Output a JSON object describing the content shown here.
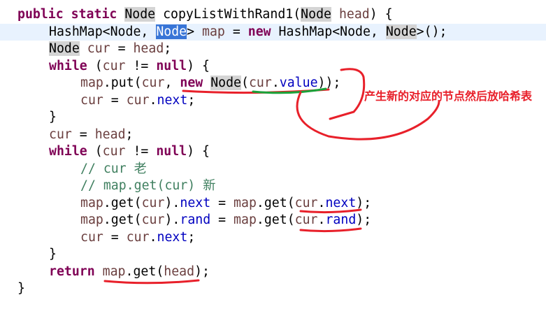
{
  "code": {
    "lines": [
      {
        "indent": 0,
        "segments": [
          {
            "t": "public",
            "c": "kw"
          },
          {
            "t": " "
          },
          {
            "t": "static",
            "c": "kw"
          },
          {
            "t": " "
          },
          {
            "t": "Node",
            "c": "hl"
          },
          {
            "t": " copyListWithRand1("
          },
          {
            "t": "Node",
            "c": "hl"
          },
          {
            "t": " "
          },
          {
            "t": "head",
            "c": "var"
          },
          {
            "t": ") {"
          }
        ]
      },
      {
        "indent": 1,
        "current": true,
        "segments": [
          {
            "t": "HashMap<Node, "
          },
          {
            "t": "Node",
            "c": "sel"
          },
          {
            "t": "> "
          },
          {
            "t": "map",
            "c": "var"
          },
          {
            "t": " = "
          },
          {
            "t": "new",
            "c": "kw"
          },
          {
            "t": " HashMap<Node, "
          },
          {
            "t": "Node",
            "c": "hl"
          },
          {
            "t": ">();"
          }
        ]
      },
      {
        "indent": 1,
        "segments": [
          {
            "t": "Node",
            "c": "hl"
          },
          {
            "t": " "
          },
          {
            "t": "cur",
            "c": "var"
          },
          {
            "t": " = "
          },
          {
            "t": "head",
            "c": "var"
          },
          {
            "t": ";"
          }
        ]
      },
      {
        "indent": 1,
        "segments": [
          {
            "t": "while",
            "c": "kw"
          },
          {
            "t": " ("
          },
          {
            "t": "cur",
            "c": "var"
          },
          {
            "t": " != "
          },
          {
            "t": "null",
            "c": "kw"
          },
          {
            "t": ") {"
          }
        ]
      },
      {
        "indent": 2,
        "segments": [
          {
            "t": "map",
            "c": "var"
          },
          {
            "t": ".put("
          },
          {
            "t": "cur",
            "c": "var"
          },
          {
            "t": ", "
          },
          {
            "t": "new",
            "c": "kw"
          },
          {
            "t": " "
          },
          {
            "t": "Node",
            "c": "hl"
          },
          {
            "t": "("
          },
          {
            "t": "cur",
            "c": "var"
          },
          {
            "t": "."
          },
          {
            "t": "value",
            "c": "fld"
          },
          {
            "t": "));"
          }
        ]
      },
      {
        "indent": 2,
        "segments": [
          {
            "t": "cur",
            "c": "var"
          },
          {
            "t": " = "
          },
          {
            "t": "cur",
            "c": "var"
          },
          {
            "t": "."
          },
          {
            "t": "next",
            "c": "fld"
          },
          {
            "t": ";"
          }
        ]
      },
      {
        "indent": 1,
        "segments": [
          {
            "t": "}"
          }
        ]
      },
      {
        "indent": 1,
        "segments": [
          {
            "t": "cur",
            "c": "var"
          },
          {
            "t": " = "
          },
          {
            "t": "head",
            "c": "var"
          },
          {
            "t": ";"
          }
        ]
      },
      {
        "indent": 1,
        "segments": [
          {
            "t": "while",
            "c": "kw"
          },
          {
            "t": " ("
          },
          {
            "t": "cur",
            "c": "var"
          },
          {
            "t": " != "
          },
          {
            "t": "null",
            "c": "kw"
          },
          {
            "t": ") {"
          }
        ]
      },
      {
        "indent": 2,
        "segments": [
          {
            "t": "// cur 老",
            "c": "cmt"
          }
        ]
      },
      {
        "indent": 2,
        "segments": [
          {
            "t": "// map.get(cur) 新",
            "c": "cmt"
          }
        ]
      },
      {
        "indent": 2,
        "segments": [
          {
            "t": "map",
            "c": "var"
          },
          {
            "t": ".get("
          },
          {
            "t": "cur",
            "c": "var"
          },
          {
            "t": ")."
          },
          {
            "t": "next",
            "c": "fld"
          },
          {
            "t": " = "
          },
          {
            "t": "map",
            "c": "var"
          },
          {
            "t": ".get("
          },
          {
            "t": "cur",
            "c": "var"
          },
          {
            "t": "."
          },
          {
            "t": "next",
            "c": "fld"
          },
          {
            "t": ");"
          }
        ]
      },
      {
        "indent": 2,
        "segments": [
          {
            "t": "map",
            "c": "var"
          },
          {
            "t": ".get("
          },
          {
            "t": "cur",
            "c": "var"
          },
          {
            "t": ")."
          },
          {
            "t": "rand",
            "c": "fld"
          },
          {
            "t": " = "
          },
          {
            "t": "map",
            "c": "var"
          },
          {
            "t": ".get("
          },
          {
            "t": "cur",
            "c": "var"
          },
          {
            "t": "."
          },
          {
            "t": "rand",
            "c": "fld"
          },
          {
            "t": ");"
          }
        ]
      },
      {
        "indent": 2,
        "segments": [
          {
            "t": "cur",
            "c": "var"
          },
          {
            "t": " = "
          },
          {
            "t": "cur",
            "c": "var"
          },
          {
            "t": "."
          },
          {
            "t": "next",
            "c": "fld"
          },
          {
            "t": ";"
          }
        ]
      },
      {
        "indent": 1,
        "segments": [
          {
            "t": "}"
          }
        ]
      },
      {
        "indent": 1,
        "segments": [
          {
            "t": "return",
            "c": "kw"
          },
          {
            "t": " "
          },
          {
            "t": "map",
            "c": "var"
          },
          {
            "t": ".get("
          },
          {
            "t": "head",
            "c": "var"
          },
          {
            "t": ");"
          }
        ]
      },
      {
        "indent": 0,
        "segments": [
          {
            "t": "}"
          }
        ]
      }
    ]
  },
  "annotation": {
    "text": "产生新的对应的节点然后放哈希表",
    "color": "#e8202a",
    "secondary_color": "#1aa33a"
  }
}
